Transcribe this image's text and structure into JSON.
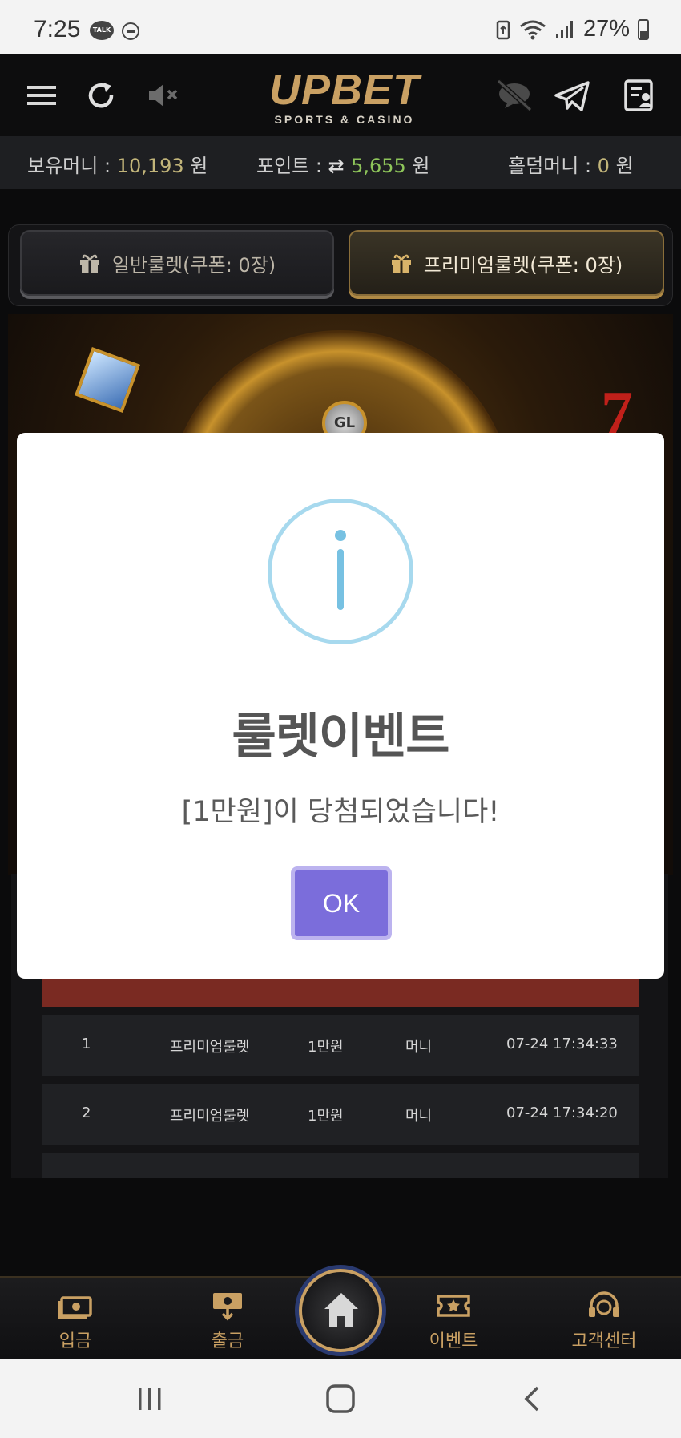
{
  "status_bar": {
    "time": "7:25",
    "battery": "27%",
    "icons": [
      "kakaotalk-icon",
      "do-not-disturb-icon",
      "battery-saver-icon",
      "wifi-icon",
      "signal-icon",
      "battery-icon"
    ]
  },
  "header": {
    "logo_main": "UPBET",
    "logo_sub": "SPORTS & CASINO",
    "icons": [
      "menu-icon",
      "refresh-icon",
      "mute-icon",
      "speech-off-icon",
      "telegram-icon",
      "notice-icon"
    ]
  },
  "money": {
    "hold_label": "보유머니 : ",
    "hold_value": "10,193",
    "hold_unit": " 원",
    "point_label": "포인트 : ",
    "point_value": "5,655",
    "point_unit": " 원",
    "holdem_label": "홀덤머니 : ",
    "holdem_value": "0",
    "holdem_unit": " 원"
  },
  "tabs": [
    {
      "label": "일반룰렛(쿠폰: 0장)"
    },
    {
      "label": "프리미엄룰렛(쿠폰: 0장)"
    }
  ],
  "art": {
    "wheel_badge": "GL",
    "seven": "7"
  },
  "history": {
    "rows": [
      {
        "no": "1",
        "type": "프리미엄룰렛",
        "amount": "1만원",
        "kind": "머니",
        "date": "07-24 17:34:33"
      },
      {
        "no": "2",
        "type": "프리미엄룰렛",
        "amount": "1만원",
        "kind": "머니",
        "date": "07-24 17:34:20"
      }
    ]
  },
  "modal": {
    "title": "룰렛이벤트",
    "message": "[1만원]이 당첨되었습니다!",
    "ok_label": "OK",
    "icon": "info-icon",
    "accent": "#7b6ddb"
  },
  "bottom_nav": {
    "items": [
      {
        "label": "입금",
        "icon": "deposit-icon"
      },
      {
        "label": "출금",
        "icon": "withdraw-icon"
      },
      {
        "label": "",
        "icon": "home-icon"
      },
      {
        "label": "이벤트",
        "icon": "event-ticket-icon"
      },
      {
        "label": "고객센터",
        "icon": "headset-icon"
      }
    ]
  },
  "colors": {
    "gold": "#c9a063",
    "green_value": "#8ec55a",
    "table_header": "#7a2a22"
  }
}
